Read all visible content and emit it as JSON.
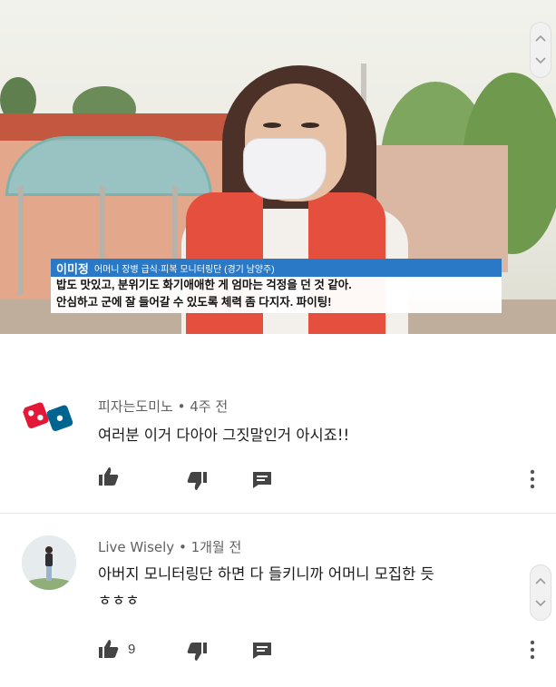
{
  "video": {
    "caption": {
      "name": "이미정",
      "description": "어머니 장병 급식·피복 모니터링단 (경기 남양주)",
      "line1": "밥도 맛있고, 분위기도 화기애애한 게 엄마는 걱정을 던 것 같아.",
      "line2": "안심하고 군에 잘 들어갈 수 있도록 체력 좀 다지자. 파이팅!"
    }
  },
  "comments": [
    {
      "author": "피자는도미노",
      "time": "4주 전",
      "text_lines": [
        "여러분 이거 다아아 그짓말인거 아시죠!!"
      ],
      "likes": "",
      "avatar_icon": "dominos-logo",
      "avatar_text": "Domino's Pizza"
    },
    {
      "author": "Live Wisely",
      "time": "1개월 전",
      "text_lines": [
        "아버지 모니터링단 하면 다 들키니까 어머니 모집한 듯",
        "ㅎㅎㅎ"
      ],
      "likes": "9",
      "avatar_icon": "person-photo"
    }
  ],
  "icons": {
    "like": "thumbs-up-icon",
    "dislike": "thumbs-down-icon",
    "reply": "reply-icon",
    "more": "more-vert-icon",
    "scroll_up": "chevron-up-icon",
    "scroll_down": "chevron-down-icon"
  },
  "colors": {
    "caption_name_bg": "#2a79c6",
    "vest": "#e4503d",
    "dominos_red": "#e31837",
    "dominos_blue": "#006491"
  }
}
